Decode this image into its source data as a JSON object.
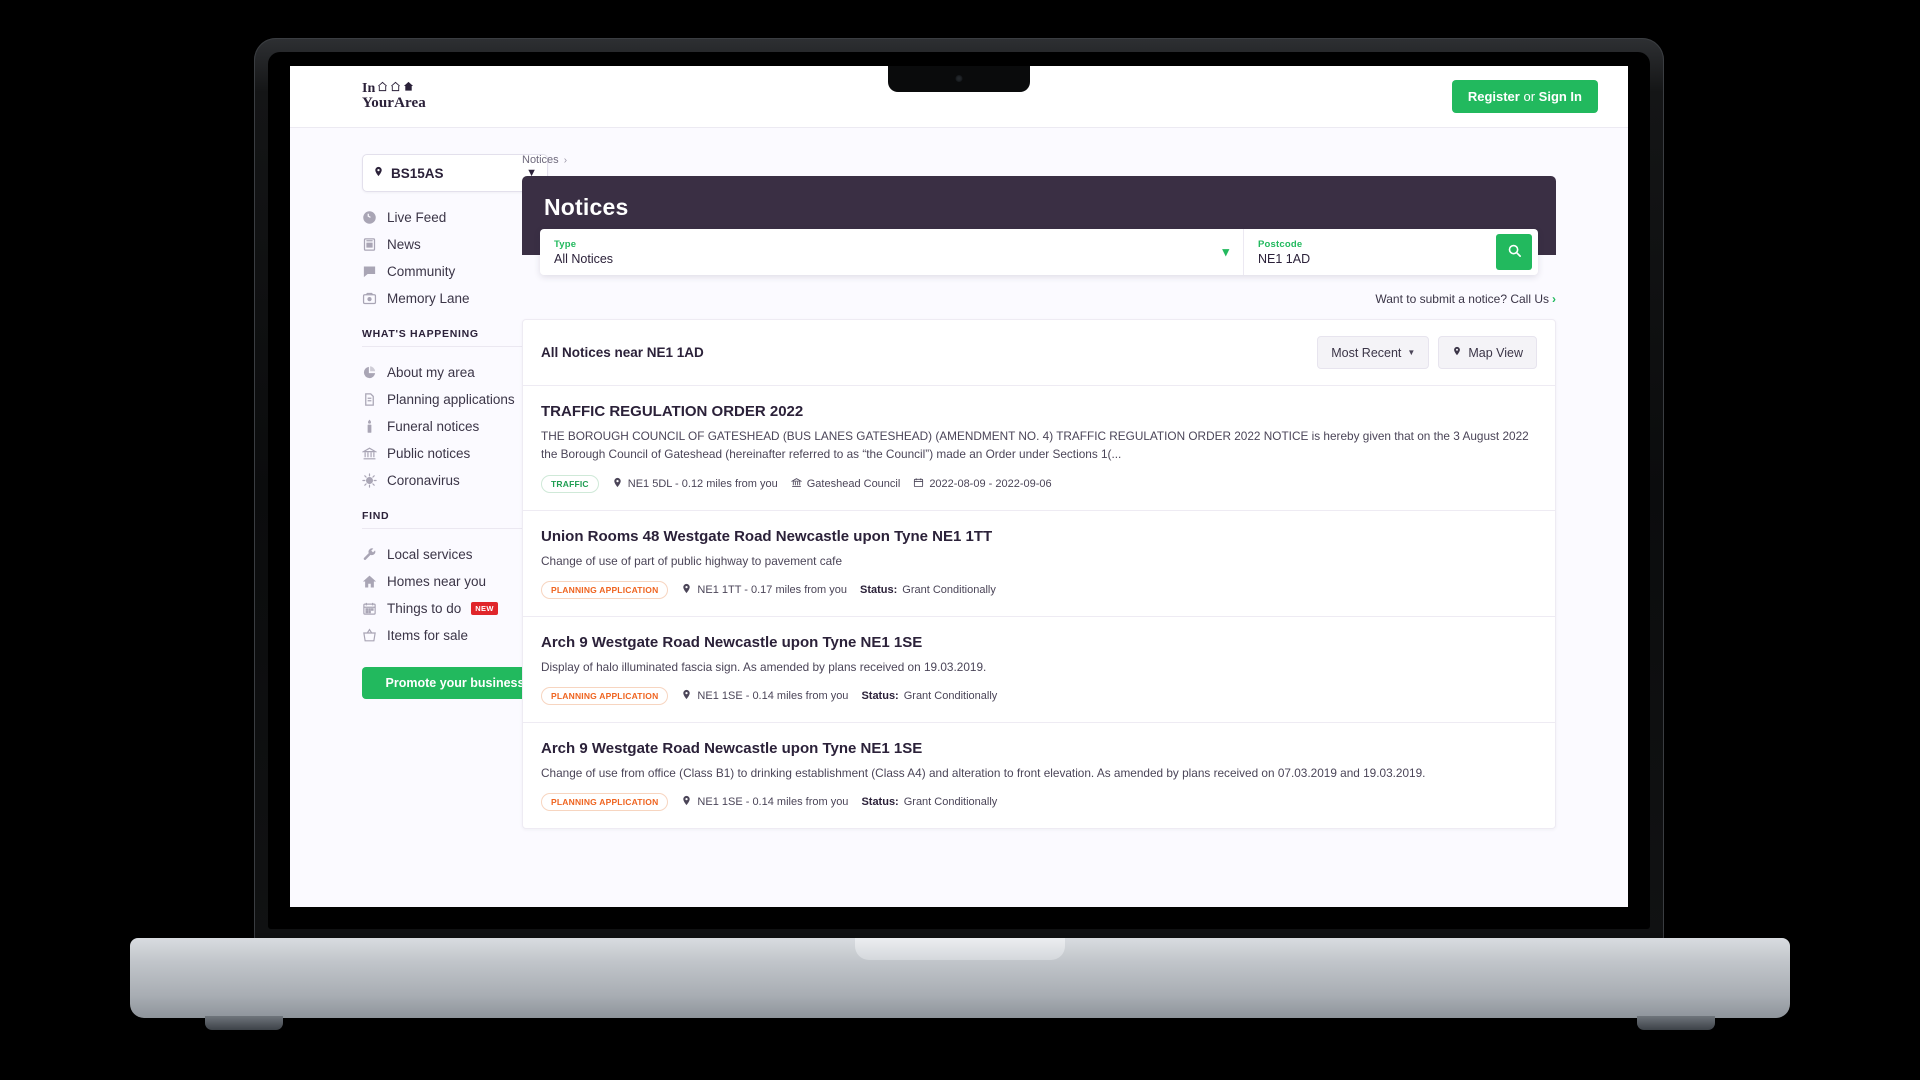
{
  "header": {
    "logo_line1": "In",
    "logo_line2": "YourArea",
    "register_label": "Register",
    "register_or": " or ",
    "register_signin": "Sign In"
  },
  "sidebar": {
    "postcode": "BS15AS",
    "primary_items": [
      {
        "label": "Live Feed",
        "icon": "clock-icon"
      },
      {
        "label": "News",
        "icon": "newspaper-icon"
      },
      {
        "label": "Community",
        "icon": "chat-bubble-icon"
      },
      {
        "label": "Memory Lane",
        "icon": "camera-icon"
      }
    ],
    "section_whats_happening": "WHAT'S HAPPENING",
    "whats_happening_items": [
      {
        "label": "About my area",
        "icon": "pie-chart-icon"
      },
      {
        "label": "Planning applications",
        "icon": "document-icon"
      },
      {
        "label": "Funeral notices",
        "icon": "candle-icon"
      },
      {
        "label": "Public notices",
        "icon": "bank-icon"
      },
      {
        "label": "Coronavirus",
        "icon": "virus-icon"
      }
    ],
    "section_find": "FIND",
    "find_items": [
      {
        "label": "Local services",
        "icon": "wrench-icon",
        "badge": ""
      },
      {
        "label": "Homes near you",
        "icon": "house-icon",
        "badge": ""
      },
      {
        "label": "Things to do",
        "icon": "calendar-icon",
        "badge": "NEW"
      },
      {
        "label": "Items for sale",
        "icon": "basket-icon",
        "badge": ""
      }
    ],
    "promote_label": "Promote your business"
  },
  "breadcrumb": {
    "item": "Notices",
    "separator": "›"
  },
  "notices_panel": {
    "title": "Notices",
    "type_label": "Type",
    "type_value": "All Notices",
    "postcode_label": "Postcode",
    "postcode_value": "NE1 1AD",
    "search_icon": "search-icon"
  },
  "submit_link": {
    "text": "Want to submit a notice? Call Us",
    "arrow": "›"
  },
  "results": {
    "heading": "All Notices near NE1 1AD",
    "sort_label": "Most Recent",
    "map_view_label": "Map View",
    "items": [
      {
        "title": "TRAFFIC REGULATION ORDER 2022",
        "description": "THE BOROUGH COUNCIL OF GATESHEAD (BUS LANES GATESHEAD) (AMENDMENT NO. 4) TRAFFIC REGULATION ORDER 2022 NOTICE is hereby given that on the 3 August 2022 the Borough Council of Gateshead (hereinafter referred to as “the Council”) made an Order under Sections 1(...",
        "tag": "TRAFFIC",
        "tag_type": "traffic",
        "location": "NE1 5DL - 0.12 miles from you",
        "council": "Gateshead Council",
        "dates": "2022-08-09 - 2022-09-06",
        "status_label": "",
        "status_value": ""
      },
      {
        "title": "Union Rooms 48 Westgate Road Newcastle upon Tyne NE1 1TT",
        "description": "Change of use of part of public highway to pavement cafe",
        "tag": "PLANNING APPLICATION",
        "tag_type": "planning",
        "location": "NE1 1TT - 0.17 miles from you",
        "council": "",
        "dates": "",
        "status_label": "Status:",
        "status_value": "Grant Conditionally"
      },
      {
        "title": "Arch 9 Westgate Road Newcastle upon Tyne NE1 1SE",
        "description": "Display of halo illuminated fascia sign. As amended by plans received on 19.03.2019.",
        "tag": "PLANNING APPLICATION",
        "tag_type": "planning",
        "location": "NE1 1SE - 0.14 miles from you",
        "council": "",
        "dates": "",
        "status_label": "Status:",
        "status_value": "Grant Conditionally"
      },
      {
        "title": "Arch 9 Westgate Road Newcastle upon Tyne NE1 1SE",
        "description": "Change of use from office (Class B1) to drinking establishment (Class A4) and alteration to front elevation. As amended by plans received on 07.03.2019 and 19.03.2019.",
        "tag": "PLANNING APPLICATION",
        "tag_type": "planning",
        "location": "NE1 1SE - 0.14 miles from you",
        "council": "",
        "dates": "",
        "status_label": "Status:",
        "status_value": "Grant Conditionally"
      }
    ]
  },
  "colors": {
    "brand_green": "#22b95e",
    "header_purple": "#3a2f44",
    "planning_orange": "#ef6420",
    "badge_red": "#e0262b"
  }
}
